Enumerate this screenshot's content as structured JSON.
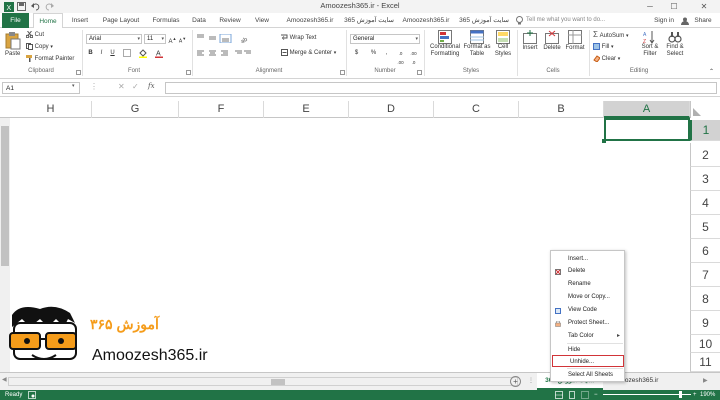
{
  "titlebar": {
    "title": "Amoozesh365.ir - Excel",
    "minimize": "─",
    "maximize": "☐",
    "close": "✕"
  },
  "tabs": {
    "file": "File",
    "items": [
      "Home",
      "Insert",
      "Page Layout",
      "Formulas",
      "Data",
      "Review",
      "View",
      "Amoozesh365.ir",
      "سایت آموزش 365",
      "Amoozesh365.ir",
      "سایت آموزش 365"
    ],
    "tellme": "Tell me what you want to do...",
    "signin": "Sign in",
    "share": "Share"
  },
  "ribbon": {
    "clipboard": {
      "paste": "Paste",
      "cut": "Cut",
      "copy": "Copy",
      "format_painter": "Format Painter",
      "label": "Clipboard"
    },
    "font": {
      "name": "Arial",
      "size": "11",
      "label": "Font",
      "bold": "B",
      "italic": "I",
      "underline": "U"
    },
    "alignment": {
      "wrap": "Wrap Text",
      "merge": "Merge & Center",
      "label": "Alignment"
    },
    "number": {
      "format": "General",
      "label": "Number",
      "currency": "$",
      "percent": "%",
      "comma": ","
    },
    "styles": {
      "conditional": "Conditional Formatting",
      "format_table": "Format as Table",
      "cell_styles": "Cell Styles",
      "label": "Styles"
    },
    "cells": {
      "insert": "Insert",
      "delete": "Delete",
      "format": "Format",
      "label": "Cells"
    },
    "editing": {
      "autosum": "AutoSum",
      "fill": "Fill",
      "clear": "Clear",
      "sort": "Sort & Filter",
      "find": "Find & Select",
      "label": "Editing"
    }
  },
  "formula_bar": {
    "cell": "A1",
    "value": ""
  },
  "columns": [
    "H",
    "G",
    "F",
    "E",
    "D",
    "C",
    "B",
    "A"
  ],
  "rows": [
    "1",
    "2",
    "3",
    "4",
    "5",
    "6",
    "7",
    "8",
    "9",
    "10",
    "11"
  ],
  "context_menu": {
    "items": [
      {
        "label": "Insert...",
        "enabled": true
      },
      {
        "label": "Delete",
        "enabled": true
      },
      {
        "label": "Rename",
        "enabled": true
      },
      {
        "label": "Move or Copy...",
        "enabled": true
      },
      {
        "label": "View Code",
        "enabled": true
      },
      {
        "label": "Protect Sheet...",
        "enabled": true
      },
      {
        "label": "Tab Color",
        "enabled": true
      },
      {
        "label": "Hide",
        "enabled": true
      },
      {
        "label": "Unhide...",
        "enabled": true
      },
      {
        "label": "Select All Sheets",
        "enabled": true
      }
    ],
    "highlighted": "Unhide..."
  },
  "sheets": [
    "سایت آموزش 365",
    "Amoozesh365.ir"
  ],
  "status": {
    "ready": "Ready",
    "zoom": "190%"
  },
  "logo": {
    "text": "Amoozesh365.ir",
    "fa_text": "آموزش ۳۶۵"
  },
  "colors": {
    "excel_green": "#217346",
    "highlight": "#d13438",
    "logo_orange": "#f59c1a"
  }
}
